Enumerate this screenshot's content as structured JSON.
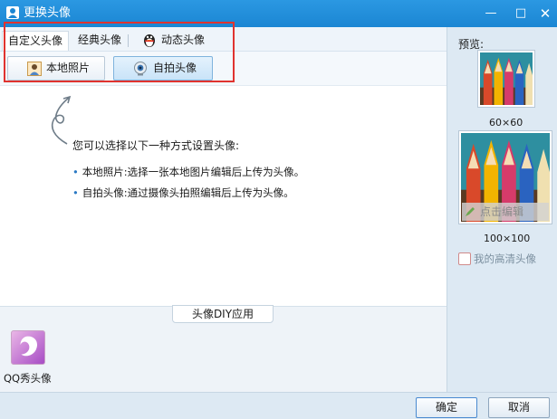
{
  "window": {
    "title": "更换头像"
  },
  "window_controls": {
    "minimize": "—",
    "maximize": "□",
    "close": "✕"
  },
  "tabs": [
    {
      "label": "自定义头像",
      "active": true
    },
    {
      "label": "经典头像",
      "active": false
    },
    {
      "label": "动态头像",
      "active": false,
      "icon": "penguin-icon"
    }
  ],
  "tools": {
    "local_photo": {
      "label": "本地照片",
      "icon": "person-photo-icon"
    },
    "selfie": {
      "label": "自拍头像",
      "icon": "webcam-icon"
    }
  },
  "content": {
    "intro": "您可以选择以下一种方式设置头像:",
    "bullet_marker": "•",
    "bullets": [
      "本地照片:选择一张本地图片编辑后上传为头像。",
      "自拍头像:通过摄像头拍照编辑后上传为头像。"
    ]
  },
  "diy": {
    "header": "头像DIY应用",
    "apps": [
      {
        "label": "QQ秀头像"
      }
    ]
  },
  "preview": {
    "label": "预览:",
    "small_size": "60×60",
    "big_size": "100×100",
    "edit_label": "点击编辑",
    "hd_link": "我的高清头像"
  },
  "buttons": {
    "ok": "确定",
    "cancel": "取消"
  },
  "colors": {
    "titlebar": "#1b86d3",
    "highlight": "#e0332f",
    "panel": "#dde9f3"
  }
}
